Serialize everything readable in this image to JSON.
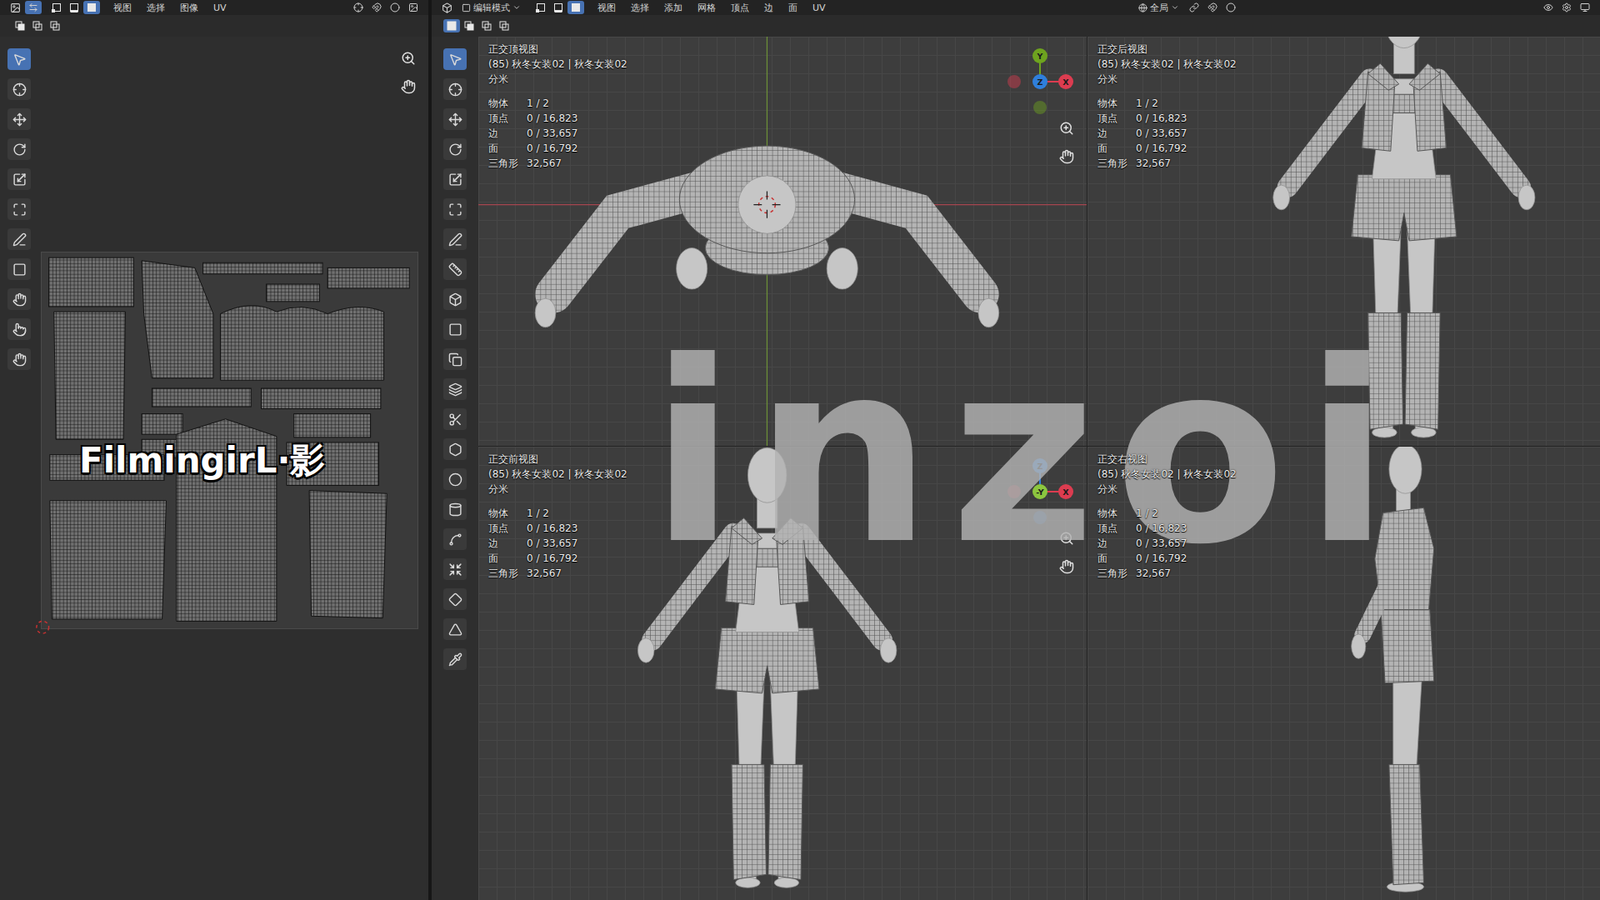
{
  "uv_editor": {
    "menus": [
      "视图",
      "选择",
      "图像",
      "UV"
    ],
    "sync_selection": true,
    "select_modes": [
      {
        "selected": false
      },
      {
        "selected": false
      },
      {
        "selected": true
      }
    ],
    "tools": [
      {
        "selected": true
      },
      {
        "selected": false
      },
      {
        "selected": false
      },
      {
        "selected": false
      },
      {
        "selected": false
      },
      {
        "selected": false
      },
      {
        "selected": false
      },
      {
        "selected": false
      },
      {
        "selected": false
      },
      {
        "selected": false
      },
      {
        "selected": false
      }
    ],
    "watermark": "FilmingirL·影"
  },
  "viewport": {
    "mode": "编辑模式",
    "select_modes": [
      {
        "selected": false
      },
      {
        "selected": false
      },
      {
        "selected": true
      }
    ],
    "menus": [
      "视图",
      "选择",
      "添加",
      "网格",
      "顶点",
      "边",
      "面",
      "UV"
    ],
    "orientation": "全局",
    "box_modes": [
      {
        "selected": true
      },
      {
        "selected": false
      },
      {
        "selected": false
      },
      {
        "selected": false
      }
    ],
    "tools": [
      {
        "selected": true
      },
      {
        "selected": false
      },
      {
        "selected": false
      },
      {
        "selected": false
      },
      {
        "selected": false
      },
      {
        "selected": false
      },
      {
        "selected": false
      },
      {
        "selected": false
      },
      {
        "selected": false
      },
      {
        "selected": false
      },
      {
        "selected": false
      },
      {
        "selected": false
      },
      {
        "selected": false
      },
      {
        "selected": false
      },
      {
        "selected": false
      },
      {
        "selected": false
      },
      {
        "selected": false
      },
      {
        "selected": false
      },
      {
        "selected": false
      },
      {
        "selected": false
      },
      {
        "selected": false
      }
    ]
  },
  "views": [
    {
      "kind": "top",
      "title": "正交顶视图",
      "object": "(85) 秋冬女装02 | 秋冬女装02",
      "unit": "分米",
      "stats": [
        {
          "label": "物体",
          "value": "1 / 2"
        },
        {
          "label": "顶点",
          "value": "0 / 16,823"
        },
        {
          "label": "边",
          "value": "0 / 33,657"
        },
        {
          "label": "面",
          "value": "0 / 16,792"
        },
        {
          "label": "三角形",
          "value": "32,567"
        }
      ],
      "gizmo": [
        {
          "label": "Y",
          "color": "#6ea31f",
          "kind": "up"
        },
        {
          "label": "Z",
          "color": "#2f7fdc",
          "kind": "center"
        },
        {
          "label": "X",
          "color": "#dc3c50",
          "kind": "right"
        }
      ]
    },
    {
      "kind": "back",
      "title": "正交后视图",
      "object": "(85) 秋冬女装02 | 秋冬女装02",
      "unit": "分米",
      "stats": [
        {
          "label": "物体",
          "value": "1 / 2"
        },
        {
          "label": "顶点",
          "value": "0 / 16,823"
        },
        {
          "label": "边",
          "value": "0 / 33,657"
        },
        {
          "label": "面",
          "value": "0 / 16,792"
        },
        {
          "label": "三角形",
          "value": "32,567"
        }
      ],
      "gizmo": []
    },
    {
      "kind": "front",
      "title": "正交前视图",
      "object": "(85) 秋冬女装02 | 秋冬女装02",
      "unit": "分米",
      "stats": [
        {
          "label": "物体",
          "value": "1 / 2"
        },
        {
          "label": "顶点",
          "value": "0 / 16,823"
        },
        {
          "label": "边",
          "value": "0 / 33,657"
        },
        {
          "label": "面",
          "value": "0 / 16,792"
        },
        {
          "label": "三角形",
          "value": "32,567"
        }
      ],
      "gizmo": [
        {
          "label": "Z",
          "color": "#2f7fdc",
          "kind": "up"
        },
        {
          "label": "-Y",
          "color": "#8cc63f",
          "kind": "center"
        },
        {
          "label": "X",
          "color": "#dc3c50",
          "kind": "right"
        }
      ]
    },
    {
      "kind": "right",
      "title": "正交右视图",
      "object": "(85) 秋冬女装02 | 秋冬女装02",
      "unit": "分米",
      "stats": [
        {
          "label": "物体",
          "value": "1 / 2"
        },
        {
          "label": "顶点",
          "value": "0 / 16,823"
        },
        {
          "label": "边",
          "value": "0 / 33,657"
        },
        {
          "label": "面",
          "value": "0 / 16,792"
        },
        {
          "label": "三角形",
          "value": "32,567"
        }
      ],
      "gizmo": []
    }
  ],
  "watermark": "inzoi"
}
